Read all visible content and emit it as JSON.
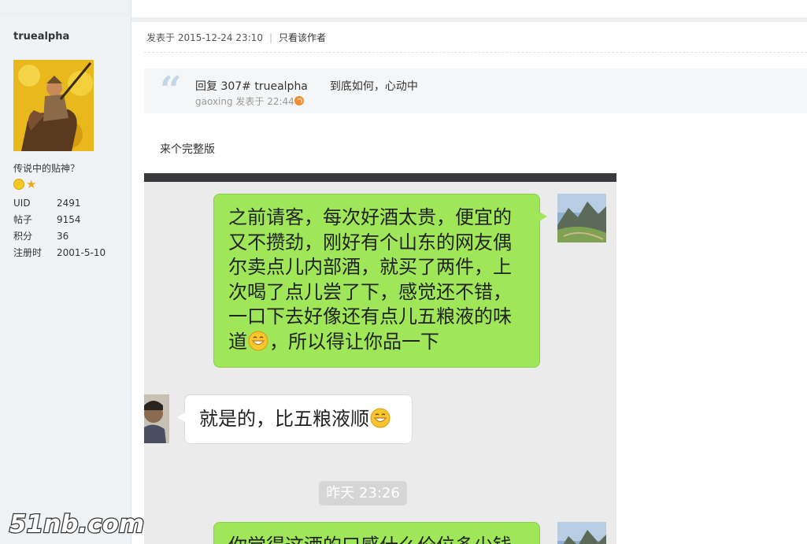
{
  "user": {
    "name": "truealpha",
    "title": "传说中的贴神？",
    "stats": [
      {
        "label": "UID",
        "value": "2491"
      },
      {
        "label": "帖子",
        "value": "9154"
      },
      {
        "label": "积分",
        "value": "36"
      },
      {
        "label": "注册时",
        "value": "2001-5-10"
      }
    ]
  },
  "post": {
    "posted_at": "发表于 2015-12-24 23:10",
    "separator": "|",
    "author_only": "只看该作者",
    "text": "来个完整版"
  },
  "quote": {
    "mark": "“",
    "reply_to": "回复 307# truealpha",
    "content": "到底如何，心动中",
    "byline": "gaoxing 发表于 22:44"
  },
  "chat": {
    "msg1_part1": "之前请客，每次好酒太贵，便宜的又不攒劲，刚好有个山东的网友偶尔卖点儿内部酒，就买了两件，上次喝了点儿尝了下，感觉还不错，一口下去好像还有点儿五粮液的味道",
    "msg1_part2": "，所以得让你品一下",
    "msg2": "就是的，比五粮液顺",
    "time": "昨天 23:26",
    "msg3_partial": "你觉得这酒的口感什么价位多少钱"
  },
  "watermark": "51nb.com",
  "colors": {
    "sent_bubble": "#9fe658",
    "received_bubble": "#ffffff",
    "chat_bg": "#ebebeb",
    "quote_bg": "#f5f6f7"
  }
}
